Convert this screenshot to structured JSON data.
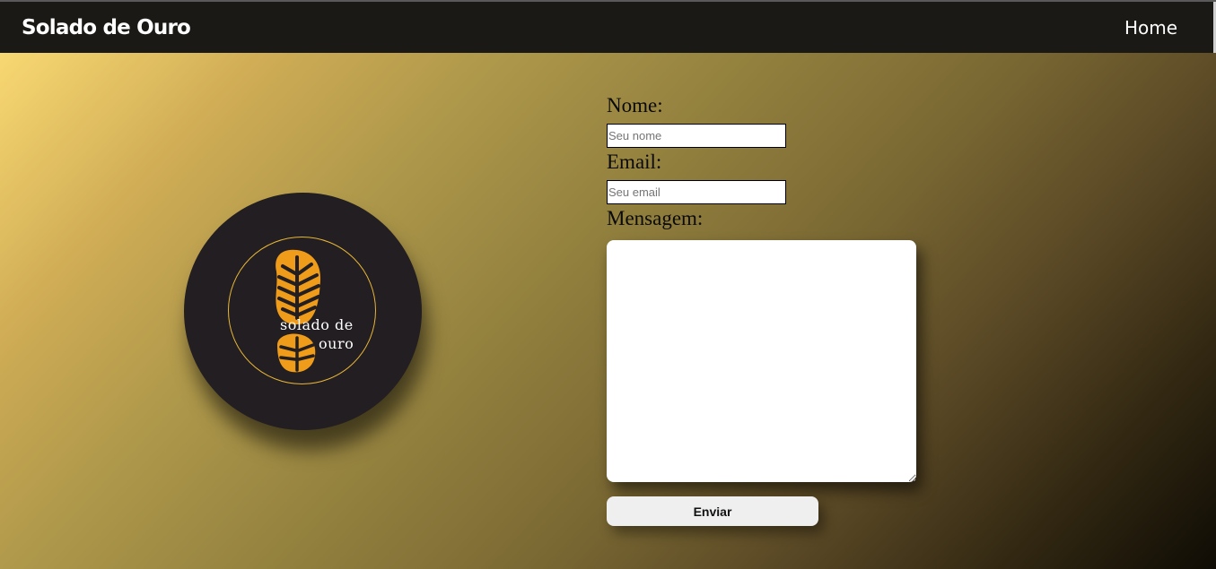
{
  "header": {
    "brand": "Solado de Ouro",
    "nav": {
      "home_label": "Home"
    }
  },
  "logo": {
    "line1": "solado de",
    "line2": "ouro",
    "colors": {
      "disc": "#221e21",
      "sole": "#f09c1b",
      "ring": "#e7b637"
    }
  },
  "form": {
    "name_label": "Nome:",
    "name_placeholder": "Seu nome",
    "email_label": "Email:",
    "email_placeholder": "Seu email",
    "message_label": "Mensagem:",
    "message_value": "",
    "submit_label": "Enviar"
  }
}
